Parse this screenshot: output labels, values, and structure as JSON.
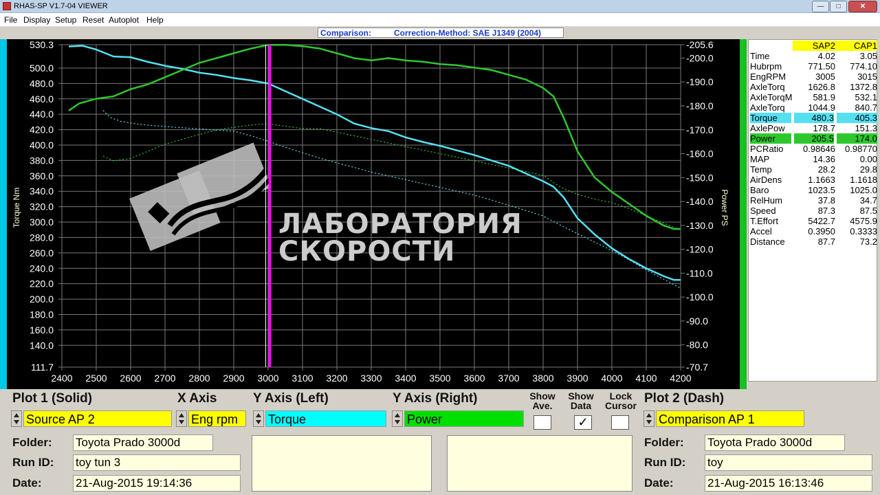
{
  "window": {
    "title": "RHAS-SP V1.7-04  VIEWER"
  },
  "menu": [
    "File",
    "Display",
    "Setup",
    "Reset",
    "Autoplot",
    "Help"
  ],
  "comparison_header": {
    "label": "Comparison:",
    "method": "Correction-Method: SAE J1349 (2004)"
  },
  "colors": {
    "torque": "#55e0f2",
    "power": "#2ec82e",
    "cursor": "#ff00ff",
    "background": "#000000",
    "grid": "#7a7a7a",
    "source_bg": "#ffff00",
    "field_bg": "#ffffe0"
  },
  "axis_labels": {
    "left": "Torque Nm",
    "right": "Power PS"
  },
  "watermark": {
    "line1": "ЛАБОРАТОРИЯ",
    "line2": "СКОРОСТИ"
  },
  "chart_data": {
    "type": "line",
    "xlabel": "",
    "xlim": [
      2400,
      4200
    ],
    "x_ticks": [
      "2400",
      "2500",
      "2600",
      "2700",
      "2800",
      "2900",
      "3000",
      "3100",
      "3200",
      "3300",
      "3400",
      "3500",
      "3600",
      "3700",
      "3800",
      "3900",
      "4000",
      "4100",
      "4200"
    ],
    "y_left_label": "Torque Nm",
    "y_left_lim": [
      111.7,
      530.3
    ],
    "y_left_ticks": [
      "530.3",
      "500.0",
      "480.0",
      "460.0",
      "440.0",
      "420.0",
      "400.0",
      "380.0",
      "360.0",
      "340.0",
      "320.0",
      "300.0",
      "280.0",
      "260.0",
      "240.0",
      "220.0",
      "200.0",
      "180.0",
      "160.0",
      "140.0",
      "111.7"
    ],
    "y_right_label": "Power PS",
    "y_right_lim": [
      70.7,
      205.6
    ],
    "y_right_ticks": [
      "205.6",
      "200.0",
      "190.0",
      "180.0",
      "170.0",
      "160.0",
      "150.0",
      "140.0",
      "130.0",
      "120.0",
      "110.0",
      "100.0",
      "90.0",
      "80.0",
      "70.7"
    ],
    "cursor_x": 3005,
    "grid": true,
    "series": [
      {
        "name": "Torque",
        "axis": "left",
        "style": "solid",
        "color": "#55e0f2",
        "x": [
          2420,
          2460,
          2500,
          2550,
          2600,
          2650,
          2700,
          2750,
          2800,
          2850,
          2900,
          2950,
          3000,
          3050,
          3100,
          3150,
          3200,
          3250,
          3300,
          3350,
          3400,
          3450,
          3500,
          3550,
          3600,
          3650,
          3700,
          3750,
          3800,
          3830,
          3860,
          3900,
          3950,
          4000,
          4050,
          4100,
          4150,
          4180,
          4200
        ],
        "y": [
          528,
          529,
          524,
          515,
          514,
          508,
          503,
          499,
          494,
          491,
          487,
          484,
          480,
          470,
          460,
          450,
          440,
          428,
          422,
          418,
          410,
          404,
          399,
          393,
          387,
          380,
          373,
          363,
          353,
          346,
          332,
          305,
          284,
          266,
          252,
          240,
          230,
          225,
          225
        ]
      },
      {
        "name": "Power",
        "axis": "right",
        "style": "solid",
        "color": "#2ec82e",
        "x": [
          2420,
          2450,
          2500,
          2550,
          2600,
          2650,
          2700,
          2750,
          2800,
          2850,
          2900,
          2950,
          3000,
          3050,
          3100,
          3150,
          3200,
          3250,
          3300,
          3350,
          3400,
          3450,
          3500,
          3550,
          3600,
          3650,
          3700,
          3750,
          3800,
          3830,
          3860,
          3900,
          3950,
          4000,
          4050,
          4100,
          4150,
          4180,
          4200
        ],
        "y": [
          178,
          181,
          183,
          184,
          187,
          189,
          192,
          195,
          198,
          200,
          202,
          204,
          205.5,
          205.5,
          205,
          204,
          202,
          200,
          199,
          200,
          199,
          198.5,
          197.5,
          197,
          196,
          195,
          193,
          191,
          187.5,
          184,
          175,
          161,
          150,
          144,
          139,
          134,
          130,
          128.5,
          128.5
        ]
      },
      {
        "name": "Torque (comparison)",
        "axis": "left",
        "style": "dash",
        "color": "#55e0f2",
        "x": [
          2520,
          2540,
          2570,
          2620,
          2700,
          2800,
          2900,
          2950,
          3000,
          3050,
          3100,
          3150,
          3200,
          3300,
          3400,
          3500,
          3600,
          3700,
          3800,
          3850,
          3900,
          3950,
          4000,
          4050,
          4100,
          4150,
          4200
        ],
        "y": [
          445,
          436,
          431,
          427,
          424,
          421,
          418,
          412,
          405,
          397,
          390,
          383,
          377,
          365,
          355,
          345,
          335,
          322,
          308,
          296,
          285,
          274,
          263,
          251,
          238,
          226,
          214
        ]
      },
      {
        "name": "Power (comparison)",
        "axis": "right",
        "style": "dash",
        "color": "#2ec82e",
        "x": [
          2520,
          2550,
          2600,
          2650,
          2700,
          2800,
          2850,
          2900,
          2950,
          3000,
          3050,
          3100,
          3150,
          3200,
          3300,
          3400,
          3500,
          3600,
          3700,
          3800,
          3850,
          3900,
          3950,
          4000,
          4050,
          4100,
          4150,
          4200
        ],
        "y": [
          159,
          157,
          158,
          161,
          164,
          168,
          170,
          171,
          172,
          172.5,
          171.5,
          170.5,
          170.5,
          169,
          166,
          163,
          160,
          157,
          154,
          151,
          146,
          143,
          141,
          139.5,
          137,
          134,
          131,
          128
        ]
      }
    ]
  },
  "data_table": {
    "headers": [
      "SAP2",
      "CAP1"
    ],
    "rows": [
      {
        "label": "Time",
        "v1": "4.02",
        "v2": "3.05"
      },
      {
        "label": "Hubrpm",
        "v1": "771.50",
        "v2": "774.10"
      },
      {
        "label": "EngRPM",
        "v1": "3005",
        "v2": "3015"
      },
      {
        "label": "AxleTorq",
        "v1": "1626.8",
        "v2": "1372.8"
      },
      {
        "label": "AxleTorqM",
        "v1": "581.9",
        "v2": "532.1"
      },
      {
        "label": "AxleTorq",
        "v1": "1044.9",
        "v2": "840.7"
      },
      {
        "label": "Torque",
        "v1": "480.3",
        "v2": "405.3",
        "highlight": "cyan"
      },
      {
        "label": "AxlePow",
        "v1": "178.7",
        "v2": "151.3"
      },
      {
        "label": "Power",
        "v1": "205.5",
        "v2": "174.0",
        "highlight": "green"
      },
      {
        "label": "PCRatio",
        "v1": "0.98646",
        "v2": "0.98770"
      },
      {
        "label": "MAP",
        "v1": "14.36",
        "v2": "0.00"
      },
      {
        "label": "Temp",
        "v1": "28.2",
        "v2": "29.8"
      },
      {
        "label": "AirDens",
        "v1": "1.1663",
        "v2": "1.1618"
      },
      {
        "label": "Baro",
        "v1": "1023.5",
        "v2": "1025.0"
      },
      {
        "label": "RelHum",
        "v1": "37.8",
        "v2": "34.7"
      },
      {
        "label": "Speed",
        "v1": "87.3",
        "v2": "87.5"
      },
      {
        "label": "T.Effort",
        "v1": "5422.7",
        "v2": "4575.9"
      },
      {
        "label": "Accel",
        "v1": "0.3950",
        "v2": "0.3333"
      },
      {
        "label": "Distance",
        "v1": "87.7",
        "v2": "73.2"
      }
    ]
  },
  "controls": {
    "plot1_label": "Plot 1 (Solid)",
    "xaxis_label": "X Axis",
    "yleft_label": "Y Axis (Left)",
    "yright_label": "Y Axis (Right)",
    "show_ave_label": "Show Ave.",
    "show_data_label": "Show Data",
    "lock_cursor_label": "Lock Cursor",
    "plot2_label": "Plot 2 (Dash)",
    "plot1_value": "Source AP 2",
    "xaxis_value": "Eng rpm",
    "yleft_value": "Torque",
    "yright_value": "Power",
    "plot2_value": "Comparison AP 1",
    "show_ave_checked": false,
    "show_data_checked": true,
    "lock_cursor_checked": false,
    "check_mark": "✓"
  },
  "run1": {
    "folder_label": "Folder:",
    "folder": "Toyota Prado 3000d",
    "runid_label": "Run ID:",
    "runid": "toy tun 3",
    "date_label": "Date:",
    "date": "21-Aug-2015   19:14:36"
  },
  "run2": {
    "folder_label": "Folder:",
    "folder": "Toyota Prado 3000d",
    "runid_label": "Run ID:",
    "runid": "toy",
    "date_label": "Date:",
    "date": "21-Aug-2015   16:13:46"
  }
}
